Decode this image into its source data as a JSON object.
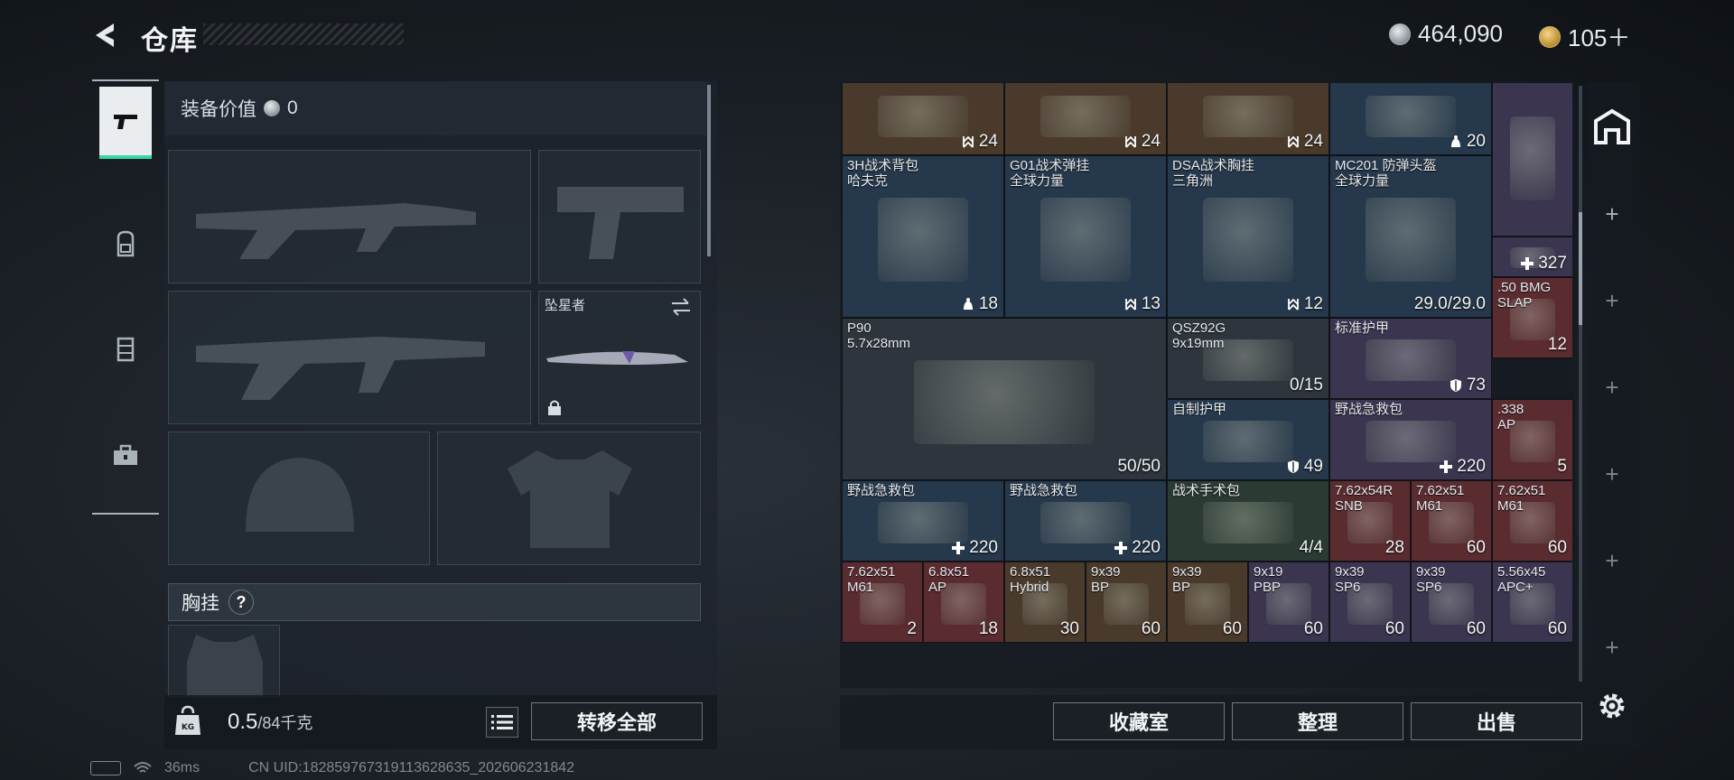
{
  "header": {
    "title": "仓库",
    "silver_amount": "464,090",
    "gold_amount": "105＋"
  },
  "nav": {
    "items": [
      "pistol-icon",
      "backpack-icon",
      "vest-icon",
      "toolbox-icon"
    ],
    "active": "pistol-icon"
  },
  "equipment": {
    "value_label": "装备价值",
    "value_amount": "0",
    "melee_slot_name": "坠星者",
    "chest_rig_label": "胸挂",
    "help_symbol": "?",
    "weight_current": "0.5",
    "weight_max": "/84千克",
    "transfer_all_label": "转移全部"
  },
  "inventory": {
    "cells": [
      {
        "name": "",
        "count": "24",
        "icon": "capacity-icon",
        "color": "brown"
      },
      {
        "name": "",
        "count": "24",
        "icon": "capacity-icon",
        "color": "brown"
      },
      {
        "name": "",
        "count": "24",
        "icon": "capacity-icon",
        "color": "brown"
      },
      {
        "name": "",
        "count": "20",
        "icon": "durability-icon",
        "color": "blue"
      },
      {
        "name": "",
        "count": "",
        "icon": "",
        "color": "purple"
      },
      {
        "name": "3H战术背包\n哈夫克",
        "count": "18",
        "icon": "durability-icon",
        "color": "blue"
      },
      {
        "name": "G01战术弹挂\n全球力量",
        "count": "13",
        "icon": "capacity-icon",
        "color": "blue"
      },
      {
        "name": "DSA战术胸挂\n三角洲",
        "count": "12",
        "icon": "capacity-icon",
        "color": "blue"
      },
      {
        "name": "MC201 防弹头盔\n全球力量",
        "count": "29.0/29.0",
        "icon": "",
        "color": "blue"
      },
      {
        "name": "",
        "count": "327",
        "icon": "heal-icon",
        "color": "purple"
      },
      {
        "name": ".50 BMG\nSLAP",
        "count": "12",
        "icon": "",
        "color": "red"
      },
      {
        "name": "P90\n5.7x28mm",
        "count": "50/50",
        "icon": "",
        "color": "grey"
      },
      {
        "name": "QSZ92G\n9x19mm",
        "count": "0/15",
        "icon": "",
        "color": "grey"
      },
      {
        "name": "标准护甲",
        "count": "73",
        "icon": "shield-icon",
        "color": "purple"
      },
      {
        "name": "自制护甲",
        "count": "49",
        "icon": "shield-icon",
        "color": "blue"
      },
      {
        "name": "野战急救包",
        "count": "220",
        "icon": "plus-icon",
        "color": "purple"
      },
      {
        "name": ".338\nAP",
        "count": "5",
        "icon": "",
        "color": "red"
      },
      {
        "name": "野战急救包",
        "count": "220",
        "icon": "plus-icon",
        "color": "blue"
      },
      {
        "name": "野战急救包",
        "count": "220",
        "icon": "plus-icon",
        "color": "blue"
      },
      {
        "name": "战术手术包",
        "count": "4/4",
        "icon": "",
        "color": "green"
      },
      {
        "name": "7.62x54R\nSNB",
        "count": "28",
        "icon": "",
        "color": "red"
      },
      {
        "name": "7.62x51\nM61",
        "count": "60",
        "icon": "",
        "color": "red"
      },
      {
        "name": "7.62x51\nM61",
        "count": "60",
        "icon": "",
        "color": "red"
      },
      {
        "name": "7.62x51\nM61",
        "count": "2",
        "icon": "",
        "color": "red"
      },
      {
        "name": "6.8x51\nAP",
        "count": "18",
        "icon": "",
        "color": "red"
      },
      {
        "name": "6.8x51\nHybrid",
        "count": "30",
        "icon": "",
        "color": "brown"
      },
      {
        "name": "9x39\nBP",
        "count": "60",
        "icon": "",
        "color": "brown"
      },
      {
        "name": "9x39\nBP",
        "count": "60",
        "icon": "",
        "color": "brown"
      },
      {
        "name": "9x19\nPBP",
        "count": "60",
        "icon": "",
        "color": "purple"
      },
      {
        "name": "9x39\nSP6",
        "count": "60",
        "icon": "",
        "color": "purple"
      },
      {
        "name": "9x39\nSP6",
        "count": "60",
        "icon": "",
        "color": "purple"
      },
      {
        "name": "5.56x45\nAPC+",
        "count": "60",
        "icon": "",
        "color": "purple"
      }
    ]
  },
  "bottom_buttons": {
    "collection": "收藏室",
    "organize": "整理",
    "sell": "出售"
  },
  "status": {
    "ping": "36ms",
    "uid": "CN UID:1828597673191136286​35_202606231842"
  }
}
